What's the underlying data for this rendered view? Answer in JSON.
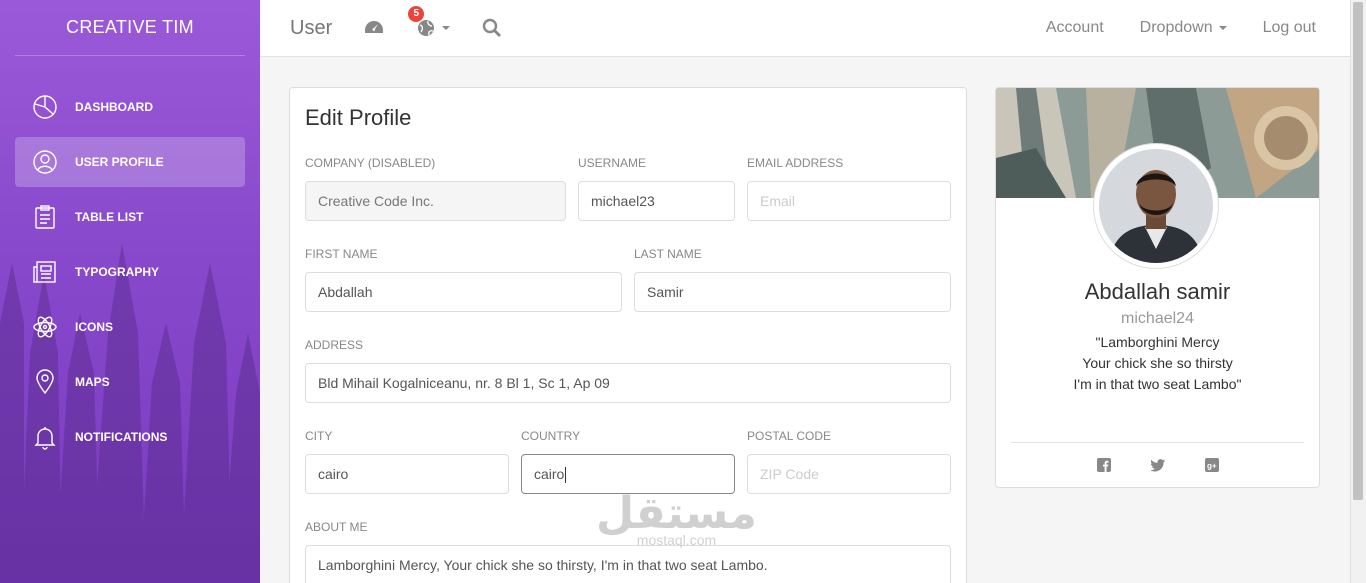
{
  "sidebar": {
    "logo": "CREATIVE TIM",
    "items": [
      {
        "label": "DASHBOARD",
        "icon": "pie-chart-icon"
      },
      {
        "label": "USER PROFILE",
        "icon": "user-circle-icon",
        "active": true
      },
      {
        "label": "TABLE LIST",
        "icon": "clipboard-icon"
      },
      {
        "label": "TYPOGRAPHY",
        "icon": "news-icon"
      },
      {
        "label": "ICONS",
        "icon": "atom-icon"
      },
      {
        "label": "MAPS",
        "icon": "map-pin-icon"
      },
      {
        "label": "NOTIFICATIONS",
        "icon": "bell-icon"
      }
    ]
  },
  "topbar": {
    "brand": "User",
    "notifications_count": "5",
    "links": {
      "account": "Account",
      "dropdown": "Dropdown",
      "logout": "Log out"
    }
  },
  "edit_profile": {
    "title": "Edit Profile",
    "company": {
      "label": "COMPANY (DISABLED)",
      "value": "Creative Code Inc."
    },
    "username": {
      "label": "USERNAME",
      "value": "michael23"
    },
    "email": {
      "label": "EMAIL ADDRESS",
      "placeholder": "Email"
    },
    "first_name": {
      "label": "FIRST NAME",
      "value": "Abdallah"
    },
    "last_name": {
      "label": "LAST NAME",
      "value": "Samir"
    },
    "address": {
      "label": "ADDRESS",
      "value": "Bld Mihail Kogalniceanu, nr. 8 Bl 1, Sc 1, Ap 09"
    },
    "city": {
      "label": "CITY",
      "value": "cairo"
    },
    "country": {
      "label": "COUNTRY",
      "value": "cairo"
    },
    "postal": {
      "label": "POSTAL CODE",
      "placeholder": "ZIP Code"
    },
    "about": {
      "label": "ABOUT ME",
      "value": "Lamborghini Mercy, Your chick she so thirsty, I'm in that two seat Lambo."
    }
  },
  "user_card": {
    "name": "Abdallah samir",
    "handle": "michael24",
    "quote_lines": [
      "\"Lamborghini Mercy",
      "Your chick she so thirsty",
      "I'm in that two seat Lambo\""
    ]
  },
  "watermark": {
    "arabic": "مستقل",
    "latin": "mostaql.com"
  },
  "colors": {
    "sidebar_top": "#9a5ad8",
    "sidebar_bottom": "#7a3bc0",
    "badge": "#e8453c"
  }
}
